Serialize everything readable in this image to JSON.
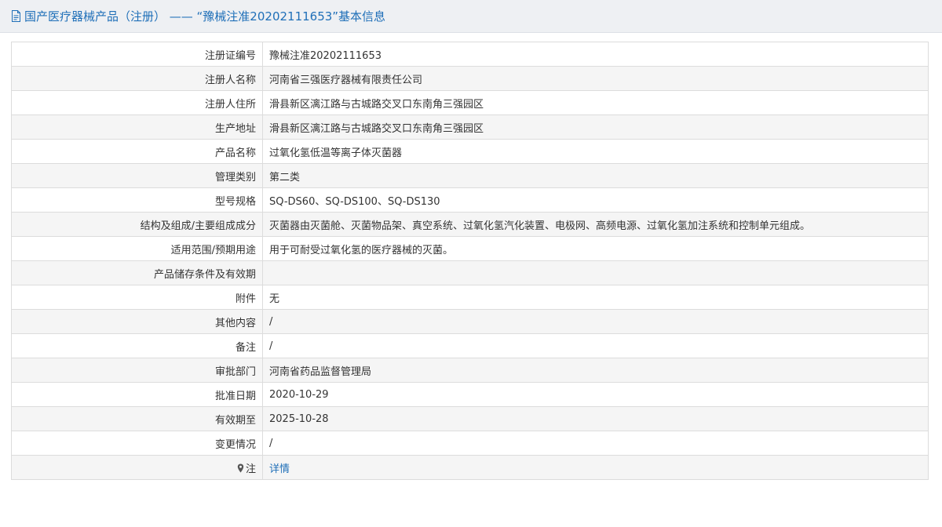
{
  "header": {
    "title": "国产医疗器械产品（注册） —— “豫械注准20202111653”基本信息",
    "icon": "document-icon"
  },
  "rows": [
    {
      "label": "注册证编号",
      "value": "豫械注准20202111653"
    },
    {
      "label": "注册人名称",
      "value": "河南省三强医疗器械有限责任公司"
    },
    {
      "label": "注册人住所",
      "value": "滑县新区漓江路与古城路交叉口东南角三强园区"
    },
    {
      "label": "生产地址",
      "value": "滑县新区漓江路与古城路交叉口东南角三强园区"
    },
    {
      "label": "产品名称",
      "value": "过氧化氢低温等离子体灭菌器"
    },
    {
      "label": "管理类别",
      "value": "第二类"
    },
    {
      "label": "型号规格",
      "value": "SQ-DS60、SQ-DS100、SQ-DS130"
    },
    {
      "label": "结构及组成/主要组成成分",
      "value": "灭菌器由灭菌舱、灭菌物品架、真空系统、过氧化氢汽化装置、电极网、高频电源、过氧化氢加注系统和控制单元组成。"
    },
    {
      "label": "适用范围/预期用途",
      "value": "用于可耐受过氧化氢的医疗器械的灭菌。"
    },
    {
      "label": "产品储存条件及有效期",
      "value": ""
    },
    {
      "label": "附件",
      "value": "无"
    },
    {
      "label": "其他内容",
      "value": "/"
    },
    {
      "label": "备注",
      "value": "/"
    },
    {
      "label": "审批部门",
      "value": "河南省药品监督管理局"
    },
    {
      "label": "批准日期",
      "value": "2020-10-29"
    },
    {
      "label": "有效期至",
      "value": "2025-10-28"
    },
    {
      "label": "变更情况",
      "value": "/"
    }
  ],
  "note_row": {
    "label": "注",
    "icon": "map-pin-icon",
    "link_text": "详情"
  },
  "colors": {
    "link": "#1f6fb8",
    "header_bg": "#eef0f3",
    "row_alt_bg": "#f5f5f5",
    "border": "#dcdcdc"
  }
}
